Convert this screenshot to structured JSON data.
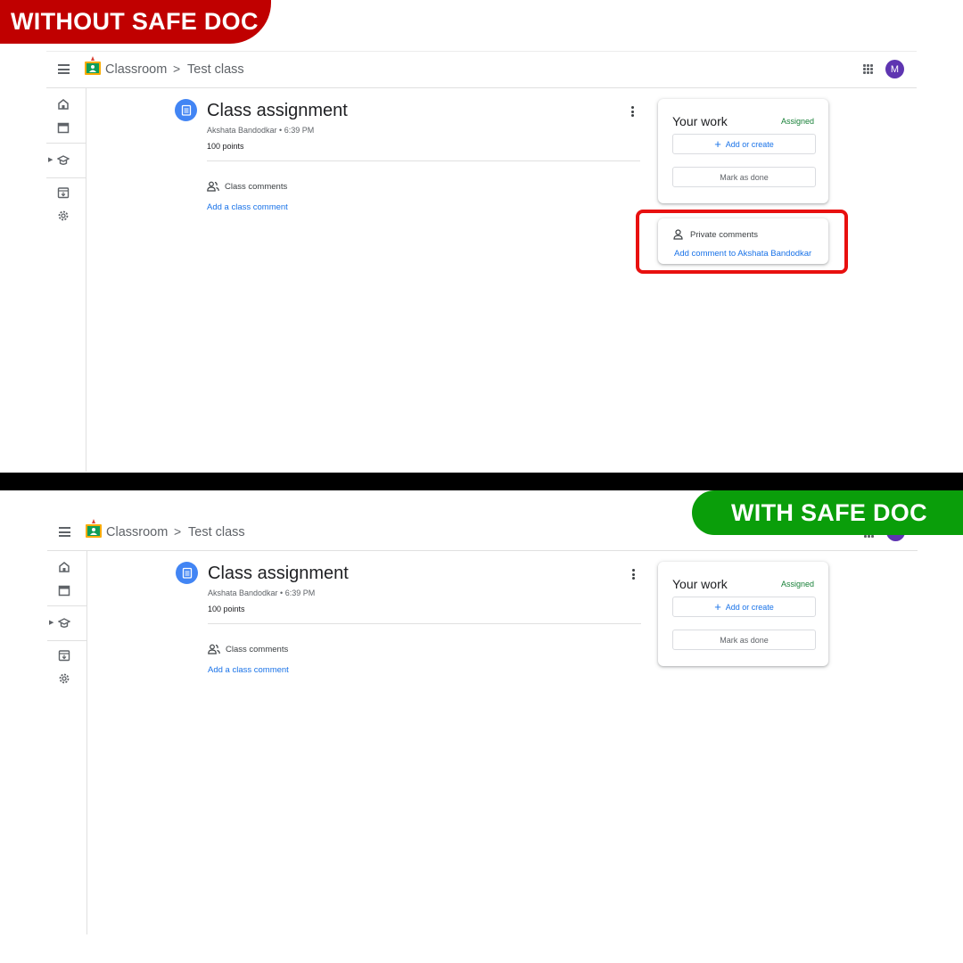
{
  "labels": {
    "without": "WITHOUT SAFE DOC",
    "with": "WITH SAFE DOC"
  },
  "colors": {
    "without_badge": "#c00000",
    "with_badge": "#0a9e0a",
    "highlight": "#e8100f",
    "link": "#1a73e8",
    "status": "#188038",
    "avatar": "#5e35b1",
    "assignment_icon": "#4285f4"
  },
  "header": {
    "app_name": "Classroom",
    "breadcrumb_separator": ">",
    "class_name": "Test class",
    "avatar_initial": "M"
  },
  "sidebar": {
    "icons": [
      "home-icon",
      "calendar-icon",
      "enrolled-classes-icon",
      "archive-icon",
      "settings-icon"
    ]
  },
  "assignment": {
    "title": "Class assignment",
    "author_time": "Akshata Bandodkar • 6:39 PM",
    "points": "100 points",
    "class_comments_label": "Class comments",
    "add_class_comment": "Add a class comment"
  },
  "your_work": {
    "title": "Your work",
    "status": "Assigned",
    "add_or_create": "Add or create",
    "add_icon": "+",
    "mark_as_done": "Mark as done"
  },
  "private_comments": {
    "label": "Private comments",
    "add_comment": "Add comment to Akshata Bandodkar"
  }
}
